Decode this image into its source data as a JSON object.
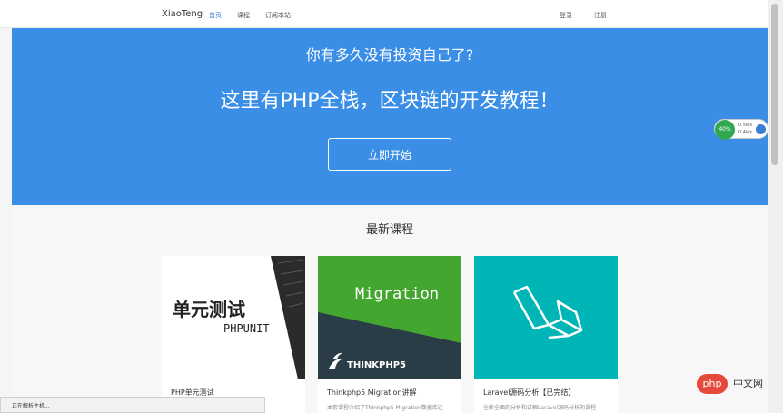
{
  "nav": {
    "brand": "XiaoTeng",
    "links": [
      "首页",
      "课程",
      "订阅本站"
    ],
    "login": "登录",
    "register": "注册"
  },
  "hero": {
    "question": "你有多久没有投资自己了?",
    "headline": "这里有PHP全栈，区块链的开发教程！",
    "button": "立即开始"
  },
  "section": {
    "title": "最新课程"
  },
  "cards": [
    {
      "img_title": "单元测试",
      "img_sub": "PHPUNIT",
      "title": "PHP单元测试",
      "desc": ""
    },
    {
      "img_title": "Migration",
      "img_sub": "THINKPHP5",
      "title": "Thinkphp5 Migration讲解",
      "desc": "本套课程介绍了Thinkphp5 Migration数据库迁"
    },
    {
      "img_title": "",
      "img_sub": "",
      "title": "Laravel源码分析【已完结】",
      "desc": "全新全面的分析和讲解Laravel源码分析的课程"
    }
  ],
  "widget": {
    "percent": "40%",
    "up": "0.5k/s",
    "down": "0.4k/s"
  },
  "status": "正在解析主机...",
  "watermark": {
    "logo": "php",
    "text": "中文网"
  },
  "colors": {
    "hero_bg": "#3a8ee6",
    "accent": "#3a7fd5",
    "migration_green": "#43a72f",
    "laravel_teal": "#00b5b6"
  }
}
